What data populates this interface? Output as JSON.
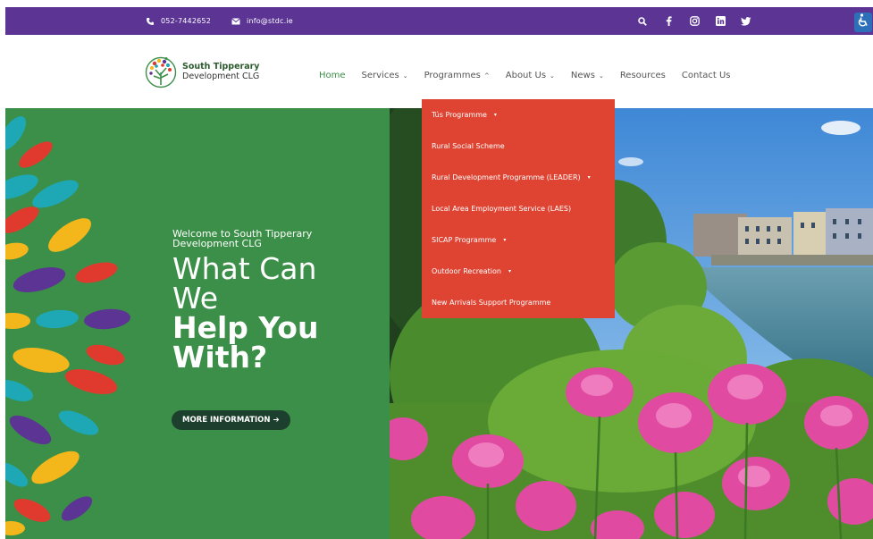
{
  "topbar": {
    "phone": "052-7442652",
    "email": "info@stdc.ie",
    "social_icons": [
      "search-icon",
      "facebook-icon",
      "instagram-icon",
      "linkedin-icon",
      "twitter-icon"
    ]
  },
  "accessibility": {
    "icon": "accessibility-icon",
    "color": "#2d6fb8"
  },
  "logo": {
    "line1": "South Tipperary",
    "line2": "Development CLG"
  },
  "nav": {
    "items": [
      {
        "label": "Home",
        "active": true,
        "has_caret": false
      },
      {
        "label": "Services",
        "caret": "⌄"
      },
      {
        "label": "Programmes",
        "caret": "^"
      },
      {
        "label": "About Us",
        "caret": "⌄"
      },
      {
        "label": "News",
        "caret": "⌄"
      },
      {
        "label": "Resources"
      },
      {
        "label": "Contact Us"
      }
    ]
  },
  "dropdown": {
    "items": [
      {
        "label": "Tús Programme",
        "has_submenu": true
      },
      {
        "label": "Rural Social Scheme",
        "has_submenu": false
      },
      {
        "label": "Rural Development Programme (LEADER)",
        "has_submenu": true
      },
      {
        "label": "Local Area Employment Service (LAES)",
        "has_submenu": false
      },
      {
        "label": "SICAP Programme",
        "has_submenu": true
      },
      {
        "label": "Outdoor Recreation",
        "has_submenu": true
      },
      {
        "label": "New Arrivals Support Programme",
        "has_submenu": false
      }
    ],
    "caret": "▾"
  },
  "hero": {
    "subtitle": "Welcome to South Tipperary Development CLG",
    "line1": "What Can",
    "line2": "We",
    "line3": "Help You",
    "line4": "With?",
    "cta": "MORE INFORMATION ➔"
  },
  "colors": {
    "topbar": "#5b3494",
    "hero_green": "#3c8f48",
    "dropdown": "#df4433",
    "nav_active": "#3b8f47",
    "cta_bg": "#1c3f2e"
  }
}
